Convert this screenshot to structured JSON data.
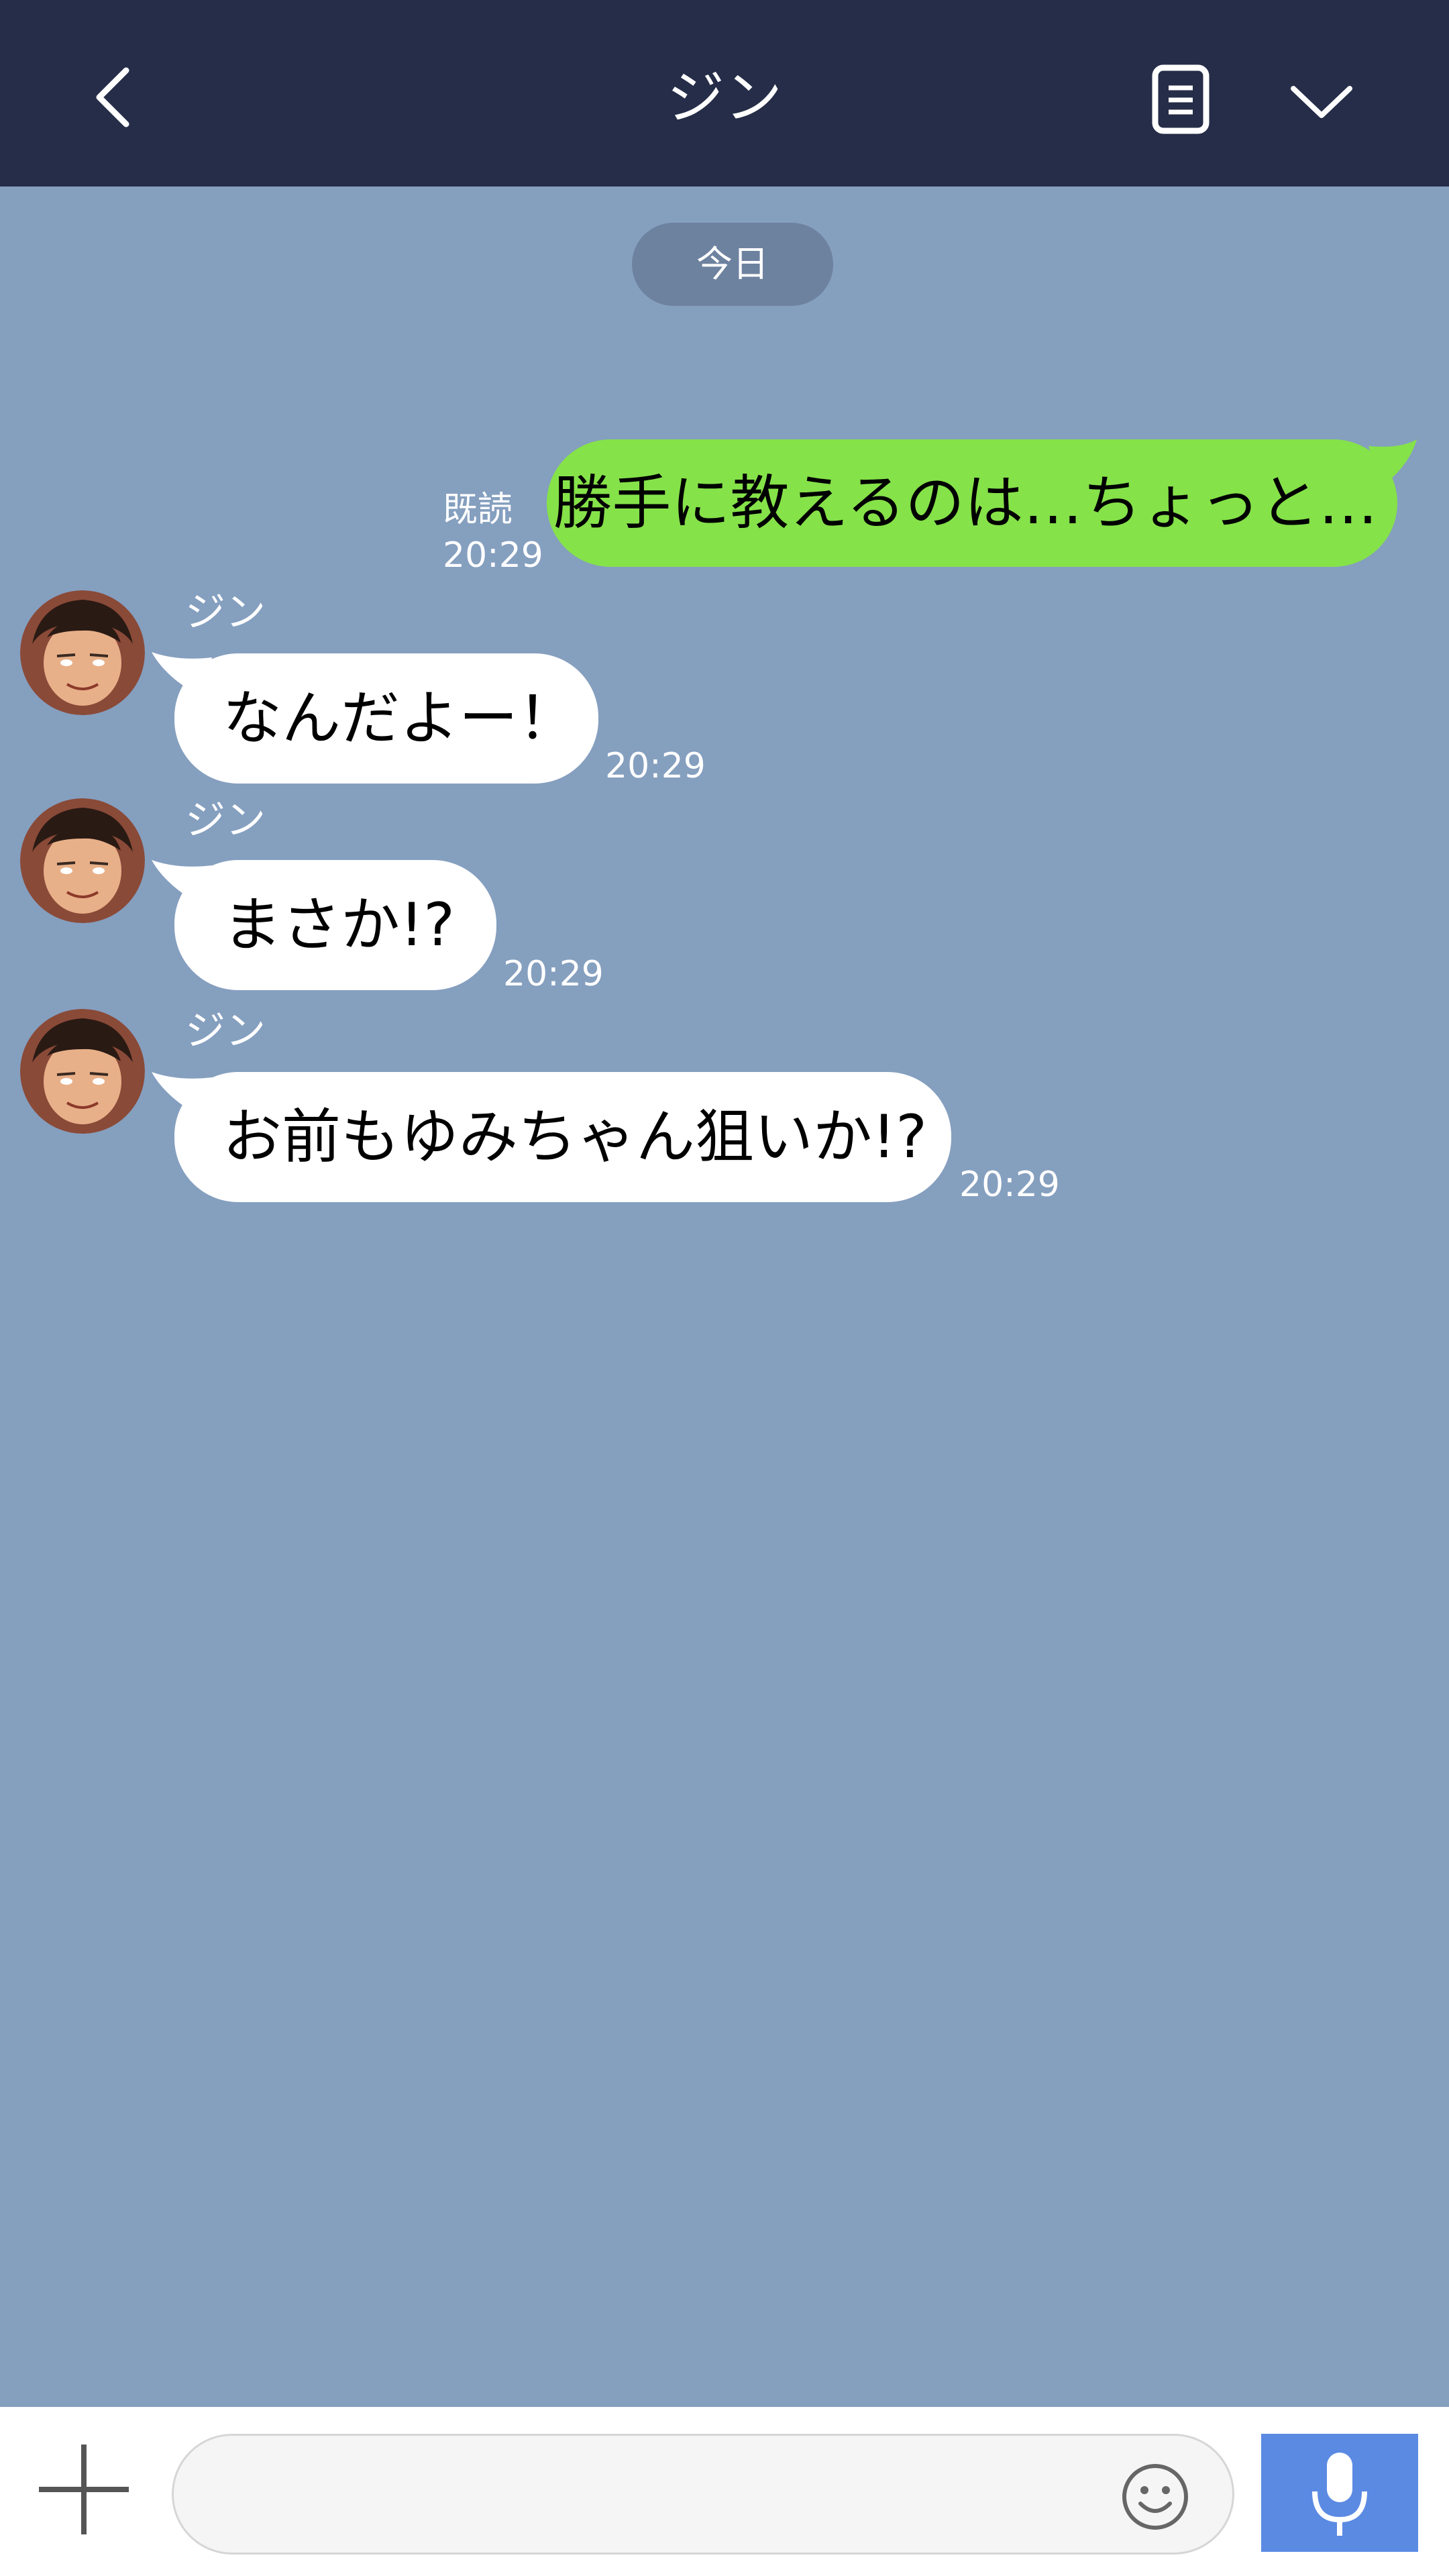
{
  "header": {
    "title": "ジン",
    "back_icon": "chevron-left-icon",
    "notes_icon": "notes-icon",
    "menu_icon": "chevron-down-icon"
  },
  "date_separator": "今日",
  "messages": [
    {
      "direction": "out",
      "text": "勝手に教えるのは…ちょっと…",
      "read_label": "既読",
      "time": "20:29"
    },
    {
      "direction": "in",
      "sender": "ジン",
      "text": "なんだよー！",
      "time": "20:29"
    },
    {
      "direction": "in",
      "sender": "ジン",
      "text": "まさか!?",
      "time": "20:29"
    },
    {
      "direction": "in",
      "sender": "ジン",
      "text": "お前もゆみちゃん狙いか!?",
      "time": "20:29"
    }
  ],
  "footer": {
    "plus_icon": "plus-icon",
    "input_value": "",
    "emoji_icon": "smiley-icon",
    "mic_icon": "microphone-icon"
  },
  "colors": {
    "header_bg": "#252d48",
    "chat_bg": "#859fbf",
    "outgoing_bubble": "#85e249",
    "incoming_bubble": "#ffffff",
    "mic_button": "#5b8ae3"
  }
}
